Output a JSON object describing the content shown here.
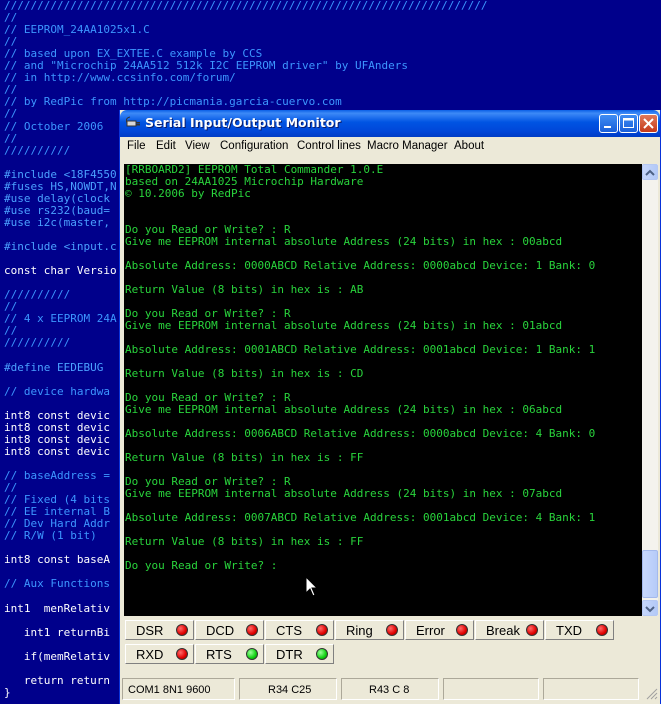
{
  "editor": {
    "lines": [
      {
        "text": "/////////////////////////////////////////////////////////////////////////",
        "cls": "c-comment"
      },
      {
        "text": "//",
        "cls": "c-comment"
      },
      {
        "text": "// EEPROM_24AA1025x1.C",
        "cls": "c-comment"
      },
      {
        "text": "//",
        "cls": "c-comment"
      },
      {
        "text": "// based upon EX_EXTEE.C example by CCS",
        "cls": "c-comment"
      },
      {
        "text": "// and \"Microchip 24AA512 512k I2C EEPROM driver\" by UFAnders",
        "cls": "c-comment"
      },
      {
        "text": "// in http://www.ccsinfo.com/forum/",
        "cls": "c-comment"
      },
      {
        "text": "//",
        "cls": "c-comment"
      },
      {
        "text": "// by RedPic from http://picmania.garcia-cuervo.com",
        "cls": "c-comment"
      },
      {
        "text": "//",
        "cls": "c-comment"
      },
      {
        "text": "// October 2006",
        "cls": "c-comment"
      },
      {
        "text": "//",
        "cls": "c-comment"
      },
      {
        "text": "//////////",
        "cls": "c-comment"
      },
      {
        "text": "",
        "cls": "c-white"
      },
      {
        "text": "#include <18F4550",
        "cls": "c-dir"
      },
      {
        "text": "#fuses HS,NOWDT,N",
        "cls": "c-dir"
      },
      {
        "text": "#use delay(clock",
        "cls": "c-dir"
      },
      {
        "text": "#use rs232(baud=",
        "cls": "c-dir"
      },
      {
        "text": "#use i2c(master,",
        "cls": "c-dir"
      },
      {
        "text": "",
        "cls": "c-white"
      },
      {
        "text": "#include <input.c",
        "cls": "c-dir"
      },
      {
        "text": "",
        "cls": "c-white"
      },
      {
        "text": "const char Versio",
        "cls": "c-white"
      },
      {
        "text": "",
        "cls": "c-white"
      },
      {
        "text": "//////////",
        "cls": "c-comment"
      },
      {
        "text": "//",
        "cls": "c-comment"
      },
      {
        "text": "// 4 x EEPROM 24A",
        "cls": "c-comment"
      },
      {
        "text": "//",
        "cls": "c-comment"
      },
      {
        "text": "//////////",
        "cls": "c-comment"
      },
      {
        "text": "",
        "cls": "c-white"
      },
      {
        "text": "#define EEDEBUG",
        "cls": "c-dir"
      },
      {
        "text": "",
        "cls": "c-white"
      },
      {
        "text": "// device hardwa",
        "cls": "c-comment"
      },
      {
        "text": "",
        "cls": "c-white"
      },
      {
        "text": "int8 const devic",
        "cls": "c-white"
      },
      {
        "text": "int8 const devic",
        "cls": "c-white"
      },
      {
        "text": "int8 const devic",
        "cls": "c-white"
      },
      {
        "text": "int8 const devic",
        "cls": "c-white"
      },
      {
        "text": "",
        "cls": "c-white"
      },
      {
        "text": "// baseAddress =",
        "cls": "c-comment"
      },
      {
        "text": "//",
        "cls": "c-comment"
      },
      {
        "text": "// Fixed (4 bits",
        "cls": "c-comment"
      },
      {
        "text": "// EE internal B",
        "cls": "c-comment"
      },
      {
        "text": "// Dev Hard Addr",
        "cls": "c-comment"
      },
      {
        "text": "// R/W (1 bit)",
        "cls": "c-comment"
      },
      {
        "text": "",
        "cls": "c-white"
      },
      {
        "text": "int8 const baseA",
        "cls": "c-white"
      },
      {
        "text": "",
        "cls": "c-white"
      },
      {
        "text": "// Aux Functions",
        "cls": "c-comment"
      },
      {
        "text": "",
        "cls": "c-white"
      },
      {
        "text": "int1  menRelativ",
        "cls": "c-white"
      },
      {
        "text": "",
        "cls": "c-white"
      },
      {
        "text": "   int1 returnBi",
        "cls": "c-white"
      },
      {
        "text": "",
        "cls": "c-white"
      },
      {
        "text": "   if(memRelativ",
        "cls": "c-white"
      },
      {
        "text": "",
        "cls": "c-white"
      },
      {
        "text": "   return return",
        "cls": "c-white"
      },
      {
        "text": "}",
        "cls": "c-white"
      }
    ]
  },
  "window": {
    "title": "Serial Input/Output Monitor",
    "menu": [
      "File",
      "Edit",
      "View",
      "Configuration",
      "Control lines",
      "Macro Manager",
      "About"
    ]
  },
  "terminal": {
    "lines": [
      "[RRBOARD2] EEPROM Total Commander 1.0.E",
      "based on 24AA1025 Microchip Hardware",
      "© 10.2006 by RedPic",
      "",
      "",
      "Do you Read or Write? : R",
      "Give me EEPROM internal absolute Address (24 bits) in hex : 00abcd",
      "",
      "Absolute Address: 0000ABCD Relative Address: 0000abcd Device: 1 Bank: 0",
      "",
      "Return Value (8 bits) in hex is : AB",
      "",
      "Do you Read or Write? : R",
      "Give me EEPROM internal absolute Address (24 bits) in hex : 01abcd",
      "",
      "Absolute Address: 0001ABCD Relative Address: 0001abcd Device: 1 Bank: 1",
      "",
      "Return Value (8 bits) in hex is : CD",
      "",
      "Do you Read or Write? : R",
      "Give me EEPROM internal absolute Address (24 bits) in hex : 06abcd",
      "",
      "Absolute Address: 0006ABCD Relative Address: 0000abcd Device: 4 Bank: 0",
      "",
      "Return Value (8 bits) in hex is : FF",
      "",
      "Do you Read or Write? : R",
      "Give me EEPROM internal absolute Address (24 bits) in hex : 07abcd",
      "",
      "Absolute Address: 0007ABCD Relative Address: 0001abcd Device: 4 Bank: 1",
      "",
      "Return Value (8 bits) in hex is : FF",
      "",
      "Do you Read or Write? :"
    ]
  },
  "signals": [
    {
      "label": "DSR",
      "state": "red"
    },
    {
      "label": "DCD",
      "state": "red"
    },
    {
      "label": "CTS",
      "state": "red"
    },
    {
      "label": "Ring",
      "state": "red"
    },
    {
      "label": "Error",
      "state": "red"
    },
    {
      "label": "Break",
      "state": "red"
    },
    {
      "label": "TXD",
      "state": "red"
    },
    {
      "label": "RXD",
      "state": "red"
    },
    {
      "label": "RTS",
      "state": "green"
    },
    {
      "label": "DTR",
      "state": "green"
    }
  ],
  "status": {
    "port": "COM1 8N1 9600",
    "pos1": "R34 C25",
    "pos2": "R43 C 8"
  },
  "colors": {
    "terminal_text": "#29d43c",
    "terminal_bg": "#000000",
    "editor_bg": "#00008b",
    "led_on": "#10d010",
    "led_off": "#e00000"
  }
}
